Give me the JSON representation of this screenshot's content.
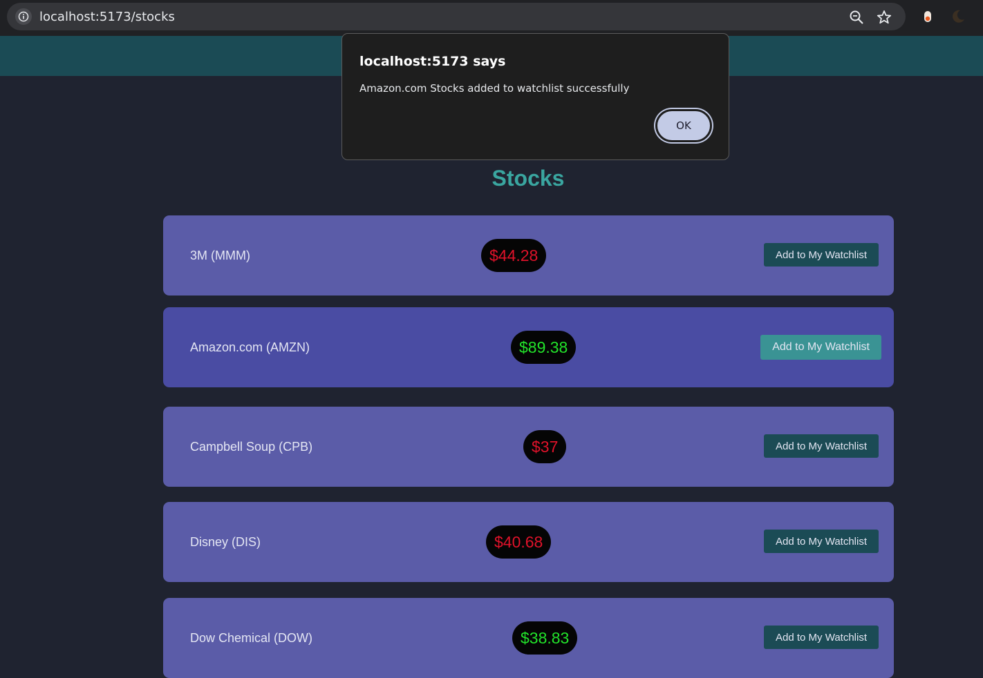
{
  "browser": {
    "url": "localhost:5173/stocks"
  },
  "page": {
    "title": "Stocks"
  },
  "stocks": [
    {
      "name": "3M (MMM)",
      "price": "$44.28",
      "trend": "down",
      "button_label": "Add to My Watchlist"
    },
    {
      "name": "Amazon.com (AMZN)",
      "price": "$89.38",
      "trend": "up",
      "button_label": "Add to My Watchlist"
    },
    {
      "name": "Campbell Soup (CPB)",
      "price": "$37",
      "trend": "down",
      "button_label": "Add to My Watchlist"
    },
    {
      "name": "Disney (DIS)",
      "price": "$40.68",
      "trend": "down",
      "button_label": "Add to My Watchlist"
    },
    {
      "name": "Dow Chemical (DOW)",
      "price": "$38.83",
      "trend": "up",
      "button_label": "Add to My Watchlist"
    }
  ],
  "alert": {
    "title": "localhost:5173 says",
    "message": "Amazon.com Stocks added to watchlist successfully",
    "ok_label": "OK"
  },
  "colors": {
    "header": "#1b4b55",
    "card": "#5b5ca8",
    "price_down": "#e0122a",
    "price_up": "#22e32a",
    "title": "#3aa6a0"
  }
}
